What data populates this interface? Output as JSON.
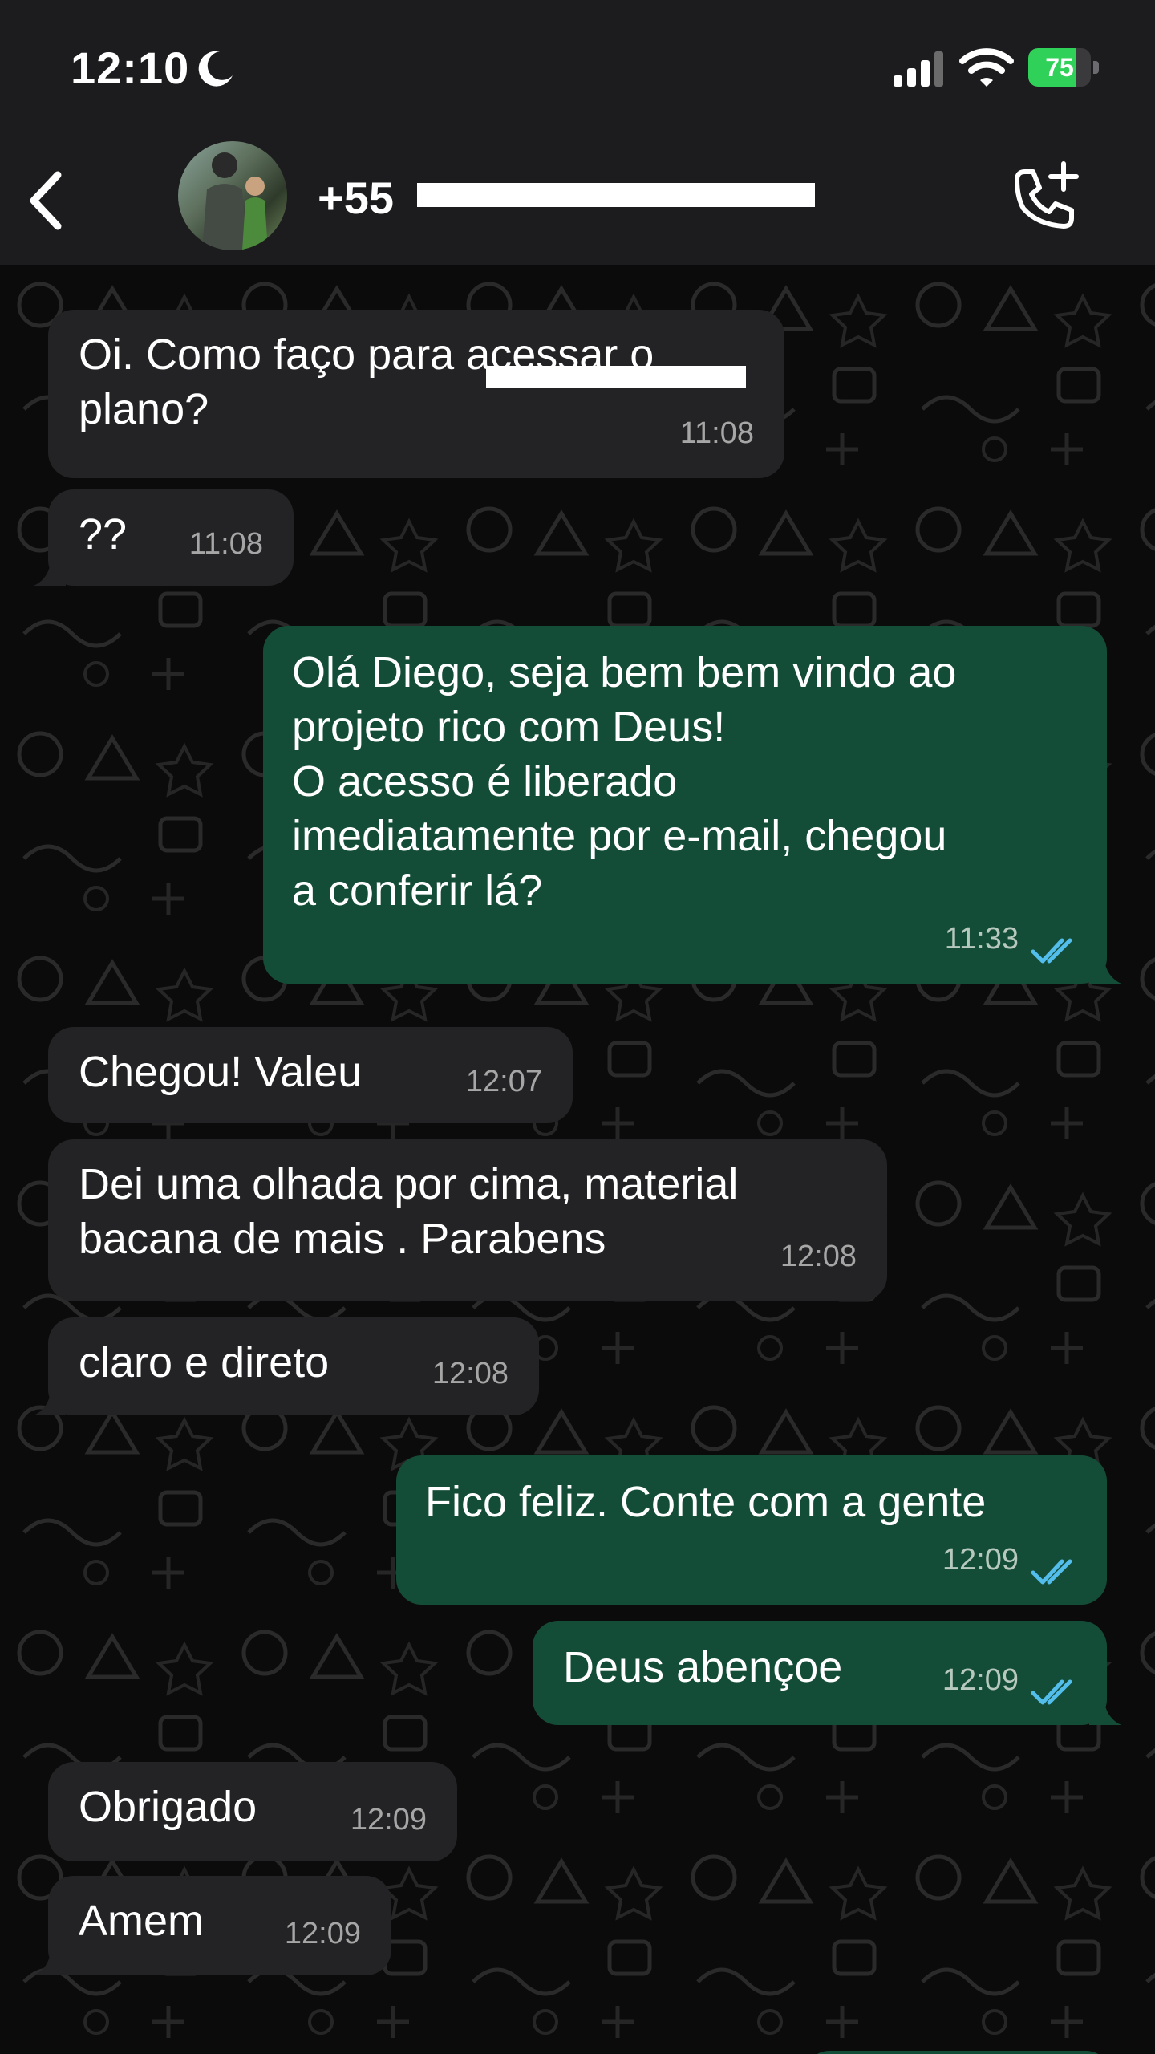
{
  "status_bar": {
    "time": "12:10",
    "battery": "75",
    "battery_level": 0.75
  },
  "header": {
    "contact_prefix": "+55"
  },
  "messages": [
    {
      "direction": "incoming",
      "text": "Oi. Como faço para acessar o\nplano?",
      "time": "11:08"
    },
    {
      "direction": "incoming",
      "text": "??",
      "time": "11:08"
    },
    {
      "direction": "outgoing",
      "text": "Olá Diego, seja bem bem vindo ao\nprojeto rico com Deus!\nO acesso é liberado\nimediatamente por e-mail, chegou\na conferir lá?",
      "time": "11:33"
    },
    {
      "direction": "incoming",
      "text": "Chegou! Valeu",
      "time": "12:07"
    },
    {
      "direction": "incoming",
      "text": "Dei uma olhada por cima, material\nbacana de mais . Parabens",
      "time": "12:08"
    },
    {
      "direction": "incoming",
      "text": "claro e direto",
      "time": "12:08"
    },
    {
      "direction": "outgoing",
      "text": "Fico feliz. Conte com a gente",
      "time": "12:09"
    },
    {
      "direction": "outgoing",
      "text": "Deus abençoe",
      "time": "12:09"
    },
    {
      "direction": "incoming",
      "text": "Obrigado",
      "time": "12:09"
    },
    {
      "direction": "incoming",
      "text": "Amem",
      "time": "12:09"
    }
  ],
  "colors": {
    "incoming_bubble": "#232325",
    "outgoing_bubble": "#144d37",
    "read_ticks": "#53bdeb",
    "header_bg": "#1c1c1e"
  },
  "icons": [
    "moon-icon",
    "signal-icon",
    "wifi-icon",
    "battery-icon",
    "back-icon",
    "call-add-icon",
    "double-check-icon"
  ]
}
